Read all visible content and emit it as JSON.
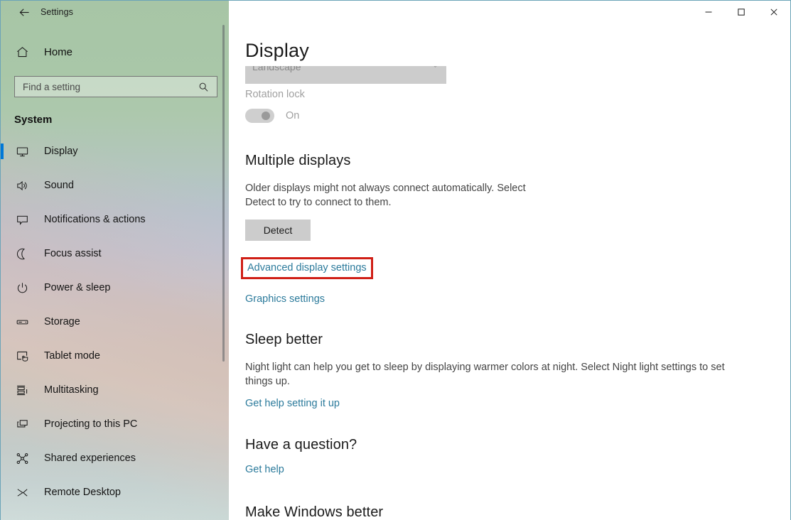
{
  "titlebar": {
    "back_icon": "back-arrow-icon",
    "title": "Settings",
    "minimize_label": "Minimize",
    "maximize_label": "Maximize",
    "close_label": "Close"
  },
  "sidebar": {
    "home": {
      "icon": "home-icon",
      "label": "Home"
    },
    "search": {
      "icon": "search-icon",
      "placeholder": "Find a setting",
      "value": ""
    },
    "group_title": "System",
    "items": [
      {
        "icon": "monitor-icon",
        "label": "Display",
        "selected": true
      },
      {
        "icon": "speaker-icon",
        "label": "Sound",
        "selected": false
      },
      {
        "icon": "notification-icon",
        "label": "Notifications & actions",
        "selected": false
      },
      {
        "icon": "moon-icon",
        "label": "Focus assist",
        "selected": false
      },
      {
        "icon": "power-icon",
        "label": "Power & sleep",
        "selected": false
      },
      {
        "icon": "drive-icon",
        "label": "Storage",
        "selected": false
      },
      {
        "icon": "tablet-icon",
        "label": "Tablet mode",
        "selected": false
      },
      {
        "icon": "multitasking-icon",
        "label": "Multitasking",
        "selected": false
      },
      {
        "icon": "projecting-icon",
        "label": "Projecting to this PC",
        "selected": false
      },
      {
        "icon": "shared-experiences-icon",
        "label": "Shared experiences",
        "selected": false
      },
      {
        "icon": "remote-desktop-icon",
        "label": "Remote Desktop",
        "selected": false
      }
    ],
    "accent_color": "#0078d7"
  },
  "main": {
    "page_title": "Display",
    "orientation": {
      "value": "Landscape",
      "chevron_icon": "chevron-down-icon",
      "disabled": true
    },
    "rotation_lock": {
      "label": "Rotation lock",
      "state": "On",
      "disabled": true
    },
    "multiple_displays": {
      "heading": "Multiple displays",
      "description": "Older displays might not always connect automatically. Select Detect to try to connect to them.",
      "detect_button": "Detect",
      "advanced_link": "Advanced display settings",
      "graphics_link": "Graphics settings",
      "highlight_color": "#d01f16"
    },
    "sleep_better": {
      "heading": "Sleep better",
      "description": "Night light can help you get to sleep by displaying warmer colors at night. Select Night light settings to set things up.",
      "help_link": "Get help setting it up"
    },
    "have_a_question": {
      "heading": "Have a question?",
      "help_link": "Get help"
    },
    "make_windows_better": {
      "heading": "Make Windows better"
    },
    "link_color": "#2b7a9b"
  }
}
